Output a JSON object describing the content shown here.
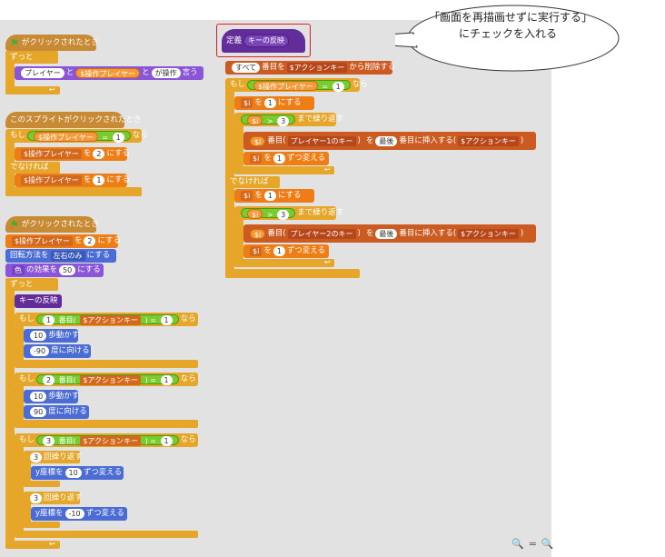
{
  "callout": {
    "text": "「画面を再描画せずに実行する」にチェックを入れる"
  },
  "zoom": {
    "out": "🔍",
    "reset": "=",
    "in": "🔍"
  },
  "left": {
    "flag_hat1": "がクリックされたとき",
    "forever1": "ずっと",
    "say_prefix": "言う",
    "say_player": "プレイヤー",
    "say_and1": "と",
    "say_opvar": "$操作プレイヤー",
    "say_and2": "と",
    "say_suffix": "が操作",
    "sprite_hat": "このスプライトがクリックされたとき",
    "if1": "もし",
    "if1_var": "$操作プレイヤー",
    "if1_eq": "=",
    "if1_num": "1",
    "if1_then": "なら",
    "set1_var": "$操作プレイヤー",
    "set1_to": "を",
    "set1_num": "2",
    "set1_suffix": "にする",
    "else1": "でなければ",
    "set2_var": "$操作プレイヤー",
    "set2_to": "を",
    "set2_num": "1",
    "set2_suffix": "にする",
    "flag_hat2": "がクリックされたとき",
    "set3_var": "$操作プレイヤー",
    "set3_to": "を",
    "set3_num": "2",
    "set3_suffix": "にする",
    "rot_label": "回転方法を",
    "rot_val": "左右のみ",
    "rot_suffix": "にする",
    "effect_label": "色",
    "effect_mid": "の効果を",
    "effect_num": "50",
    "effect_suffix": "にする",
    "forever2": "ずっと",
    "call_flip": "キーの反映",
    "ifA": "もし",
    "ifA_idx": "1",
    "ifA_item": "番目(",
    "ifA_list": "$アクションキー",
    "ifA_close": ")",
    "ifA_eq": "=",
    "ifA_num": "1",
    "ifA_then": "なら",
    "move1_num": "10",
    "move1": "歩動かす",
    "dir1_num": "-90",
    "dir1": "度に向ける",
    "ifB": "もし",
    "ifB_idx": "2",
    "ifB_item": "番目(",
    "ifB_list": "$アクションキー",
    "ifB_close": ")",
    "ifB_eq": "=",
    "ifB_num": "1",
    "ifB_then": "なら",
    "move2_num": "10",
    "move2": "歩動かす",
    "dir2_num": "90",
    "dir2": "度に向ける",
    "ifC": "もし",
    "ifC_idx": "3",
    "ifC_item": "番目(",
    "ifC_list": "$アクションキー",
    "ifC_close": ")",
    "ifC_eq": "=",
    "ifC_num": "1",
    "ifC_then": "なら",
    "rep1_num": "3",
    "rep1": "回繰り返す",
    "y1_label": "y座標を",
    "y1_num": "10",
    "y1_suffix": "ずつ変える",
    "rep2_num": "3",
    "rep2": "回繰り返す",
    "y2_label": "y座標を",
    "y2_num": "-10",
    "y2_suffix": "ずつ変える"
  },
  "right": {
    "define": "定義",
    "define_name": "キーの反映",
    "del_all": "すべて",
    "del_mid": "番目を",
    "del_list": "$アクションキー",
    "del_suffix": "から削除する",
    "if": "もし",
    "if_var": "$操作プレイヤー",
    "if_eq": "=",
    "if_num": "1",
    "if_then": "なら",
    "seti1_var": "$i",
    "seti1_to": "を",
    "seti1_num": "1",
    "seti1_suffix": "にする",
    "until1_var": "$i",
    "until1_gt": ">",
    "until1_num": "3",
    "until1_suffix": "まで繰り返す",
    "ins1_var": "$i",
    "ins1_item": "番目(",
    "ins1_list": "プレイヤー1のキー",
    "ins1_close": ")",
    "ins1_to": "を",
    "ins1_last": "最後",
    "ins1_mid": "番目に挿入する(",
    "ins1_tlist": "$アクションキー",
    "ins1_end": ")",
    "chg1_var": "$i",
    "chg1_to": "を",
    "chg1_num": "1",
    "chg1_suffix": "ずつ変える",
    "else": "でなければ",
    "seti2_var": "$i",
    "seti2_to": "を",
    "seti2_num": "1",
    "seti2_suffix": "にする",
    "until2_var": "$i",
    "until2_gt": ">",
    "until2_num": "3",
    "until2_suffix": "まで繰り返す",
    "ins2_var": "$i",
    "ins2_item": "番目(",
    "ins2_list": "プレイヤー2のキー",
    "ins2_close": ")",
    "ins2_to": "を",
    "ins2_last": "最後",
    "ins2_mid": "番目に挿入する(",
    "ins2_tlist": "$アクションキー",
    "ins2_end": ")",
    "chg2_var": "$i",
    "chg2_to": "を",
    "chg2_num": "1",
    "chg2_suffix": "ずつ変える"
  }
}
